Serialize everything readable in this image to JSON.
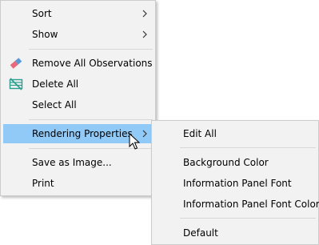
{
  "context_menu": {
    "items": [
      {
        "label": "Sort"
      },
      {
        "label": "Show"
      },
      {
        "label": "Remove All Observations",
        "icon": "eraser-icon"
      },
      {
        "label": "Delete All",
        "icon": "delete-table-icon"
      },
      {
        "label": "Select All"
      },
      {
        "label": "Rendering Properties"
      },
      {
        "label": "Save as Image..."
      },
      {
        "label": "Print"
      }
    ]
  },
  "submenu": {
    "items": [
      {
        "label": "Edit All"
      },
      {
        "label": "Background Color"
      },
      {
        "label": "Information Panel Font"
      },
      {
        "label": "Information Panel Font Color"
      },
      {
        "label": "Default"
      }
    ]
  },
  "colors": {
    "menu_background": "#f2f2f2",
    "highlight": "#91c9f7",
    "separator": "#d7d7d7"
  }
}
